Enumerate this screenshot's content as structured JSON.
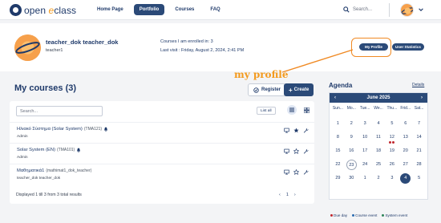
{
  "app": {
    "logo_prefix": "open ",
    "logo_e": "e",
    "logo_suffix": "class"
  },
  "nav": {
    "items": [
      "Home Page",
      "Portfolio",
      "Courses",
      "FAQ"
    ],
    "active": "Portfolio"
  },
  "search": {
    "placeholder": "Search..."
  },
  "profile": {
    "name": "teacher_dok teacher_dok",
    "username": "teacher1",
    "enrolled": "Courses I am enrolled in: 3",
    "last_visit": "Last visit : Friday, August 2, 2024, 2:41 PM",
    "my_profile_label": "My Profile",
    "user_stats_label": "User Statistics"
  },
  "annotation": {
    "text": "my profile",
    "color": "#f39a1e"
  },
  "courses": {
    "title": "My courses  (3)",
    "register_label": "Register",
    "create_label": "Create",
    "search_placeholder": "Search...",
    "list_all_label": "List all",
    "items": [
      {
        "title": "Ηλιακό Σύστημα (Solar System)",
        "code": "(TMA121)",
        "sub": "Admin",
        "favorite": true
      },
      {
        "title": "Solar System (EN)",
        "code": "(TMA101)",
        "sub": "Admin",
        "favorite": false
      },
      {
        "title": "Μαθηματικά1",
        "code": "(mathimat1_dok_teacher)",
        "sub": "teacher_dok teacher_dok",
        "favorite": false
      }
    ],
    "displayed": "Displayed 1 till 3 from 3 total results",
    "pager": {
      "prev": "‹",
      "current": "1",
      "next": "›"
    }
  },
  "agenda": {
    "title": "Agenda",
    "details_label": "Details",
    "month": "June 2025",
    "prev": "‹",
    "next": "›",
    "days": [
      "Sun...",
      "Mo...",
      "Tue...",
      "We...",
      "Thu...",
      "Frid...",
      "Sat..."
    ],
    "weeks": [
      [
        "1",
        "2",
        "3",
        "4",
        "5",
        "6",
        "7"
      ],
      [
        "8",
        "9",
        "10",
        "11",
        "12",
        "13",
        "14"
      ],
      [
        "15",
        "16",
        "17",
        "18",
        "19",
        "20",
        "21"
      ],
      [
        "22",
        "23",
        "24",
        "25",
        "26",
        "27",
        "28"
      ],
      [
        "29",
        "30",
        "1",
        "2",
        "3",
        "4",
        "5"
      ]
    ],
    "today": "23",
    "selected": "4",
    "event_day": "12",
    "legend": {
      "due": "Due day",
      "course": "Course event",
      "system": "System event"
    },
    "colors": {
      "due": "#c0262d",
      "course": "#2b6cb0",
      "system": "#2f855a",
      "header": "#2b4a78"
    }
  }
}
